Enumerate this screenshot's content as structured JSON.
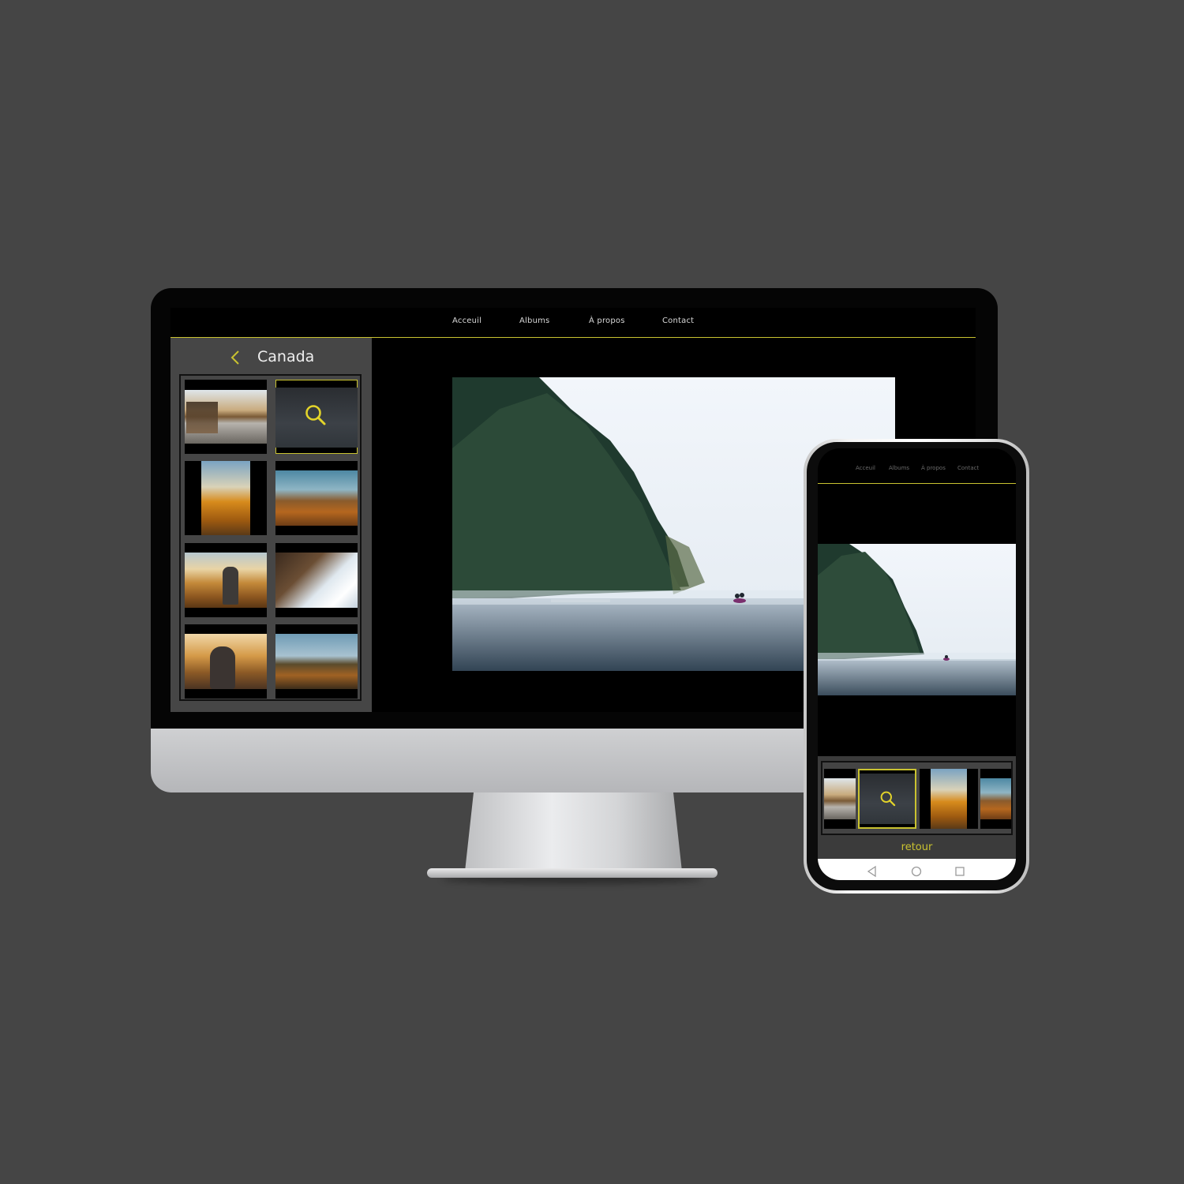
{
  "desktop": {
    "nav": {
      "links": [
        "Acceuil",
        "Albums",
        "À propos",
        "Contact"
      ]
    },
    "album": {
      "title": "Canada"
    }
  },
  "mobile": {
    "nav": {
      "links": [
        "Acceuil",
        "Albums",
        "À propos",
        "Contact"
      ]
    },
    "back_label": "retour"
  },
  "colors": {
    "accent": "#c9c230",
    "background": "#454545",
    "panel": "#464646",
    "screen": "#000000"
  },
  "icons": {
    "back": "chevron-left-icon",
    "zoom": "magnifier-icon",
    "softkeys": [
      "back-triangle-icon",
      "home-circle-icon",
      "recents-square-icon"
    ]
  }
}
